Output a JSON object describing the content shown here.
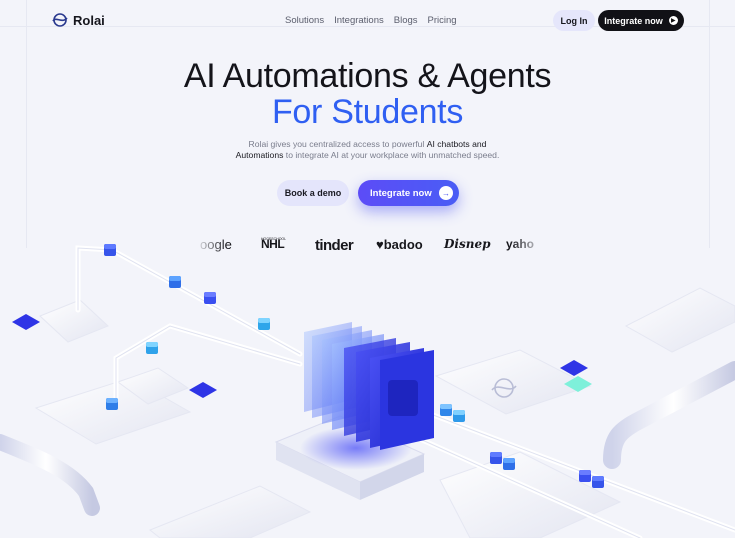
{
  "brand": {
    "name": "Rolai"
  },
  "nav": {
    "links": [
      "Solutions",
      "Integrations",
      "Blogs",
      "Pricing"
    ],
    "login_label": "Log In",
    "integrate_label": "Integrate now"
  },
  "hero": {
    "title_line1": "AI Automations & Agents",
    "title_line2": "For Students",
    "subtitle_part1": "Rolai gives you centralized access to powerful ",
    "subtitle_bold1": "AI chatbots and",
    "subtitle_bold2": "Automations",
    "subtitle_part2": " to integrate AI at your workplace with unmatched speed.",
    "demo_label": "Book a demo",
    "integrate_label": "Integrate now"
  },
  "logos": {
    "google": "oogle",
    "nhl": "NHL",
    "nhl_sub": "HOGESCHOOL",
    "tinder": "tinder",
    "badoo": "badoo",
    "disney": "Disnep",
    "yahoo": "yaho"
  },
  "colors": {
    "accent": "#2f5ff2",
    "button_primary": "#5c4cf7",
    "button_dark": "#111116",
    "button_soft": "#e4e5fb",
    "background": "#f3f4fa"
  }
}
